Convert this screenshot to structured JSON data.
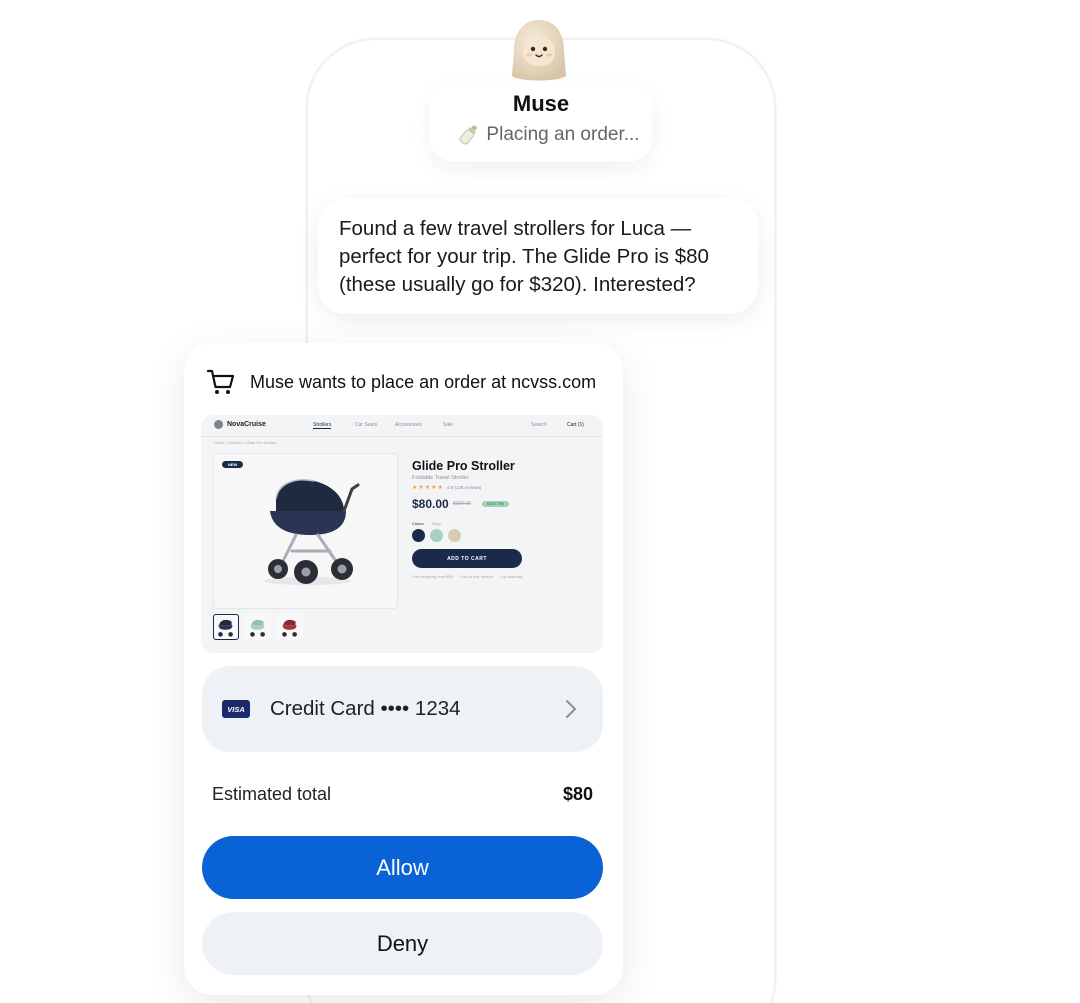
{
  "agent": {
    "name": "Muse",
    "status": "Placing an order..."
  },
  "message": "Found a few travel strollers for Luca — perfect for your trip. The Glide Pro is $80 (these usually go for $320). Interested?",
  "permission": {
    "title": "Muse wants to place an order at ncvss.com",
    "store": {
      "name": "NovaCruise",
      "nav": [
        "Strollers",
        "Car Seats",
        "Accessories",
        "Sale"
      ],
      "search_label": "Search",
      "cart_label": "Cart (1)",
      "breadcrumb": "Home / Strollers / Glide Pro Stroller",
      "badge": "NEW",
      "product": {
        "title": "Glide Pro Stroller",
        "subtitle": "Foldable Travel Stroller",
        "stars": "★★★★★",
        "rating_text": "4.8 (128 reviews)",
        "price": "$80.00",
        "old_price": "$320.00",
        "save_badge": "SAVE 75%",
        "colour_label": "Colour",
        "colour_value": "Navy",
        "add_to_cart": "ADD TO CART",
        "notes": [
          "Free shipping over $50",
          "Fold in one motion",
          "2-yr warranty"
        ]
      },
      "swatch_colors": [
        "#1b2a4a",
        "#a9cfc5",
        "#d8cbb4"
      ]
    },
    "payment": {
      "card_brand": "VISA",
      "label": "Credit Card •••• 1234"
    },
    "total_label": "Estimated total",
    "total_value": "$80",
    "allow_label": "Allow",
    "deny_label": "Deny"
  },
  "colors": {
    "primary": "#0a63d6",
    "navy": "#1b2a4a",
    "soft_bg": "#eef2f6"
  }
}
